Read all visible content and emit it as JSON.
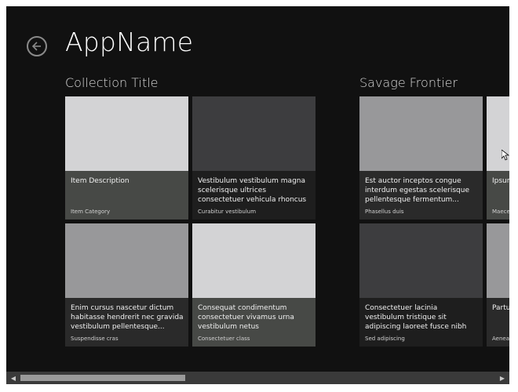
{
  "header": {
    "app_title": "AppName",
    "back_icon": "back-arrow-icon"
  },
  "groups": [
    {
      "title": "Collection Title",
      "items": [
        {
          "description": "Item Description",
          "category": "Item Category",
          "image_color": "#d3d3d5",
          "overlay_color": "#474946"
        },
        {
          "description": "Vestibulum vestibulum magna scelerisque ultrices consectetuer vehicula rhoncus pellentesque...",
          "category": "Curabitur vestibulum",
          "image_color": "#3d3d3f",
          "overlay_color": "#1e1e1e"
        },
        {
          "description": "Enim cursus nascetur dictum habitasse hendrerit nec gravida vestibulum pellentesque...",
          "category": "Suspendisse cras",
          "image_color": "#98989a",
          "overlay_color": "#2a2a2a"
        },
        {
          "description": "Consequat condimentum consectetuer vivamus urna vestibulum netus pellentesque...",
          "category": "Consectetuer class",
          "image_color": "#d3d3d5",
          "overlay_color": "#474946"
        }
      ]
    },
    {
      "title": "Savage Frontier",
      "items": [
        {
          "description": "Est auctor inceptos congue interdum egestas scelerisque pellentesque fermentum...",
          "category": "Phasellus duis",
          "image_color": "#98989a",
          "overlay_color": "#2a2a2a"
        },
        {
          "description": "Ipsum",
          "category": "Maece",
          "image_color": "#d3d3d5",
          "overlay_color": "#474946"
        },
        {
          "description": "Consectetuer lacinia vestibulum tristique sit adipiscing laoreet fusce nibh suspendisse natoque...",
          "category": "Sed adipiscing",
          "image_color": "#3d3d3f",
          "overlay_color": "#1e1e1e"
        },
        {
          "description": "Partu",
          "category": "Aenea",
          "image_color": "#98989a",
          "overlay_color": "#2a2a2a"
        }
      ]
    }
  ],
  "scrollbar": {
    "left_arrow": "◀",
    "right_arrow": "▶",
    "position_fraction": 0.0
  },
  "colors": {
    "background": "#111111",
    "scrollbar_track": "#3a3a3a",
    "scrollbar_thumb": "#9a9a9a"
  }
}
